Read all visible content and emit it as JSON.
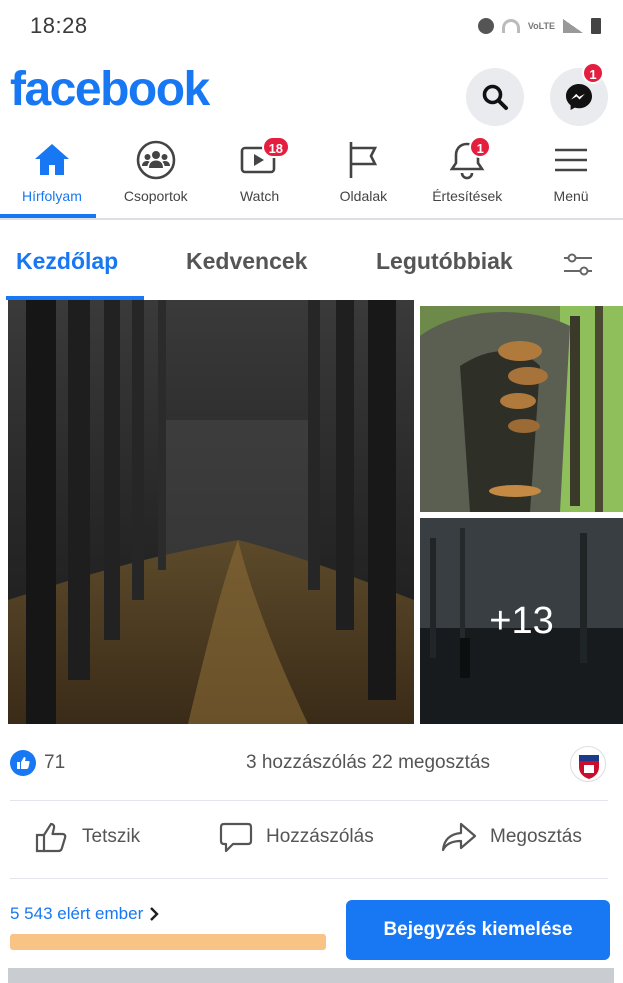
{
  "status_bar": {
    "time": "18:28",
    "network_label": "VoLTE",
    "icons": [
      "alarm-icon",
      "wifi-icon",
      "signal-icon",
      "battery-icon"
    ]
  },
  "header": {
    "logo": "facebook",
    "search_icon": "search-icon",
    "messenger_icon": "messenger-icon",
    "messenger_badge": "1"
  },
  "nav": {
    "items": [
      {
        "label": "Hírfolyam",
        "icon": "home-icon",
        "active": true
      },
      {
        "label": "Csoportok",
        "icon": "groups-icon"
      },
      {
        "label": "Watch",
        "icon": "watch-icon",
        "badge": "18"
      },
      {
        "label": "Oldalak",
        "icon": "flag-icon"
      },
      {
        "label": "Értesítések",
        "icon": "bell-icon",
        "badge": "1"
      },
      {
        "label": "Menü",
        "icon": "menu-icon"
      }
    ]
  },
  "feed_tabs": {
    "items": [
      "Kezdőlap",
      "Kedvencek",
      "Legutóbbiak"
    ],
    "active": "Kezdőlap",
    "filter_icon": "filter-icon"
  },
  "post": {
    "photos": {
      "more_count": "+13"
    },
    "like_count": "71",
    "engagement_text": "3 hozzászólás 22 megosztás",
    "actions": {
      "like": "Tetszik",
      "comment": "Hozzászólás",
      "share": "Megosztás"
    },
    "reach_text": "5 543 elért ember",
    "reach_progress": 1.0,
    "boost_label": "Bejegyzés kiemelése"
  },
  "colors": {
    "brand": "#1877f2",
    "badge": "#e41e3f",
    "reach_bar": "#f8c385"
  }
}
